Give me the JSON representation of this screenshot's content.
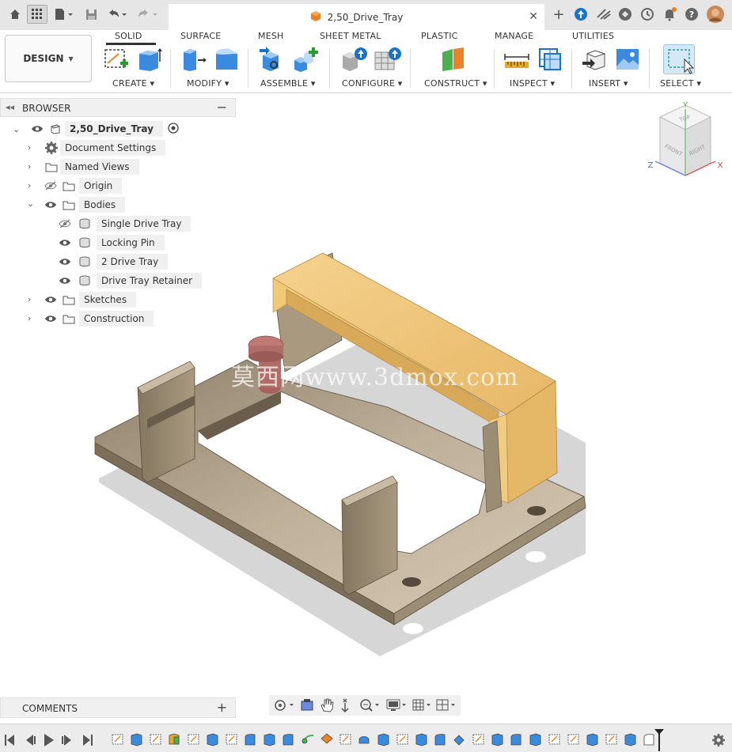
{
  "document": {
    "title": "2,50_Drive_Tray"
  },
  "workspace": {
    "label": "DESIGN"
  },
  "ribbon": {
    "tabs": [
      "SOLID",
      "SURFACE",
      "MESH",
      "SHEET METAL",
      "PLASTIC",
      "MANAGE",
      "UTILITIES"
    ],
    "active_tab": "SOLID",
    "groups": [
      "CREATE",
      "MODIFY",
      "ASSEMBLE",
      "CONFIGURE",
      "CONSTRUCT",
      "INSPECT",
      "INSERT",
      "SELECT"
    ]
  },
  "browser": {
    "title": "BROWSER",
    "root": "2,50_Drive_Tray",
    "items": {
      "document_settings": "Document Settings",
      "named_views": "Named Views",
      "origin": "Origin",
      "bodies": "Bodies",
      "sketches": "Sketches",
      "construction": "Construction"
    },
    "bodies": [
      "Single Drive Tray",
      "Locking Pin",
      "2 Drive Tray",
      "Drive Tray Retainer"
    ]
  },
  "viewcube": {
    "top": "TOP",
    "front": "FRONT",
    "right": "RIGHT",
    "axis_x": "X",
    "axis_y": "Y",
    "axis_z": "Z"
  },
  "comments": {
    "title": "COMMENTS"
  },
  "watermark": "莫西网www.3dmox.com",
  "colors": {
    "body_tan": "#c2b39c",
    "retainer": "#f0c878",
    "pin": "#c07a76",
    "accent_blue": "#1a73c8"
  }
}
